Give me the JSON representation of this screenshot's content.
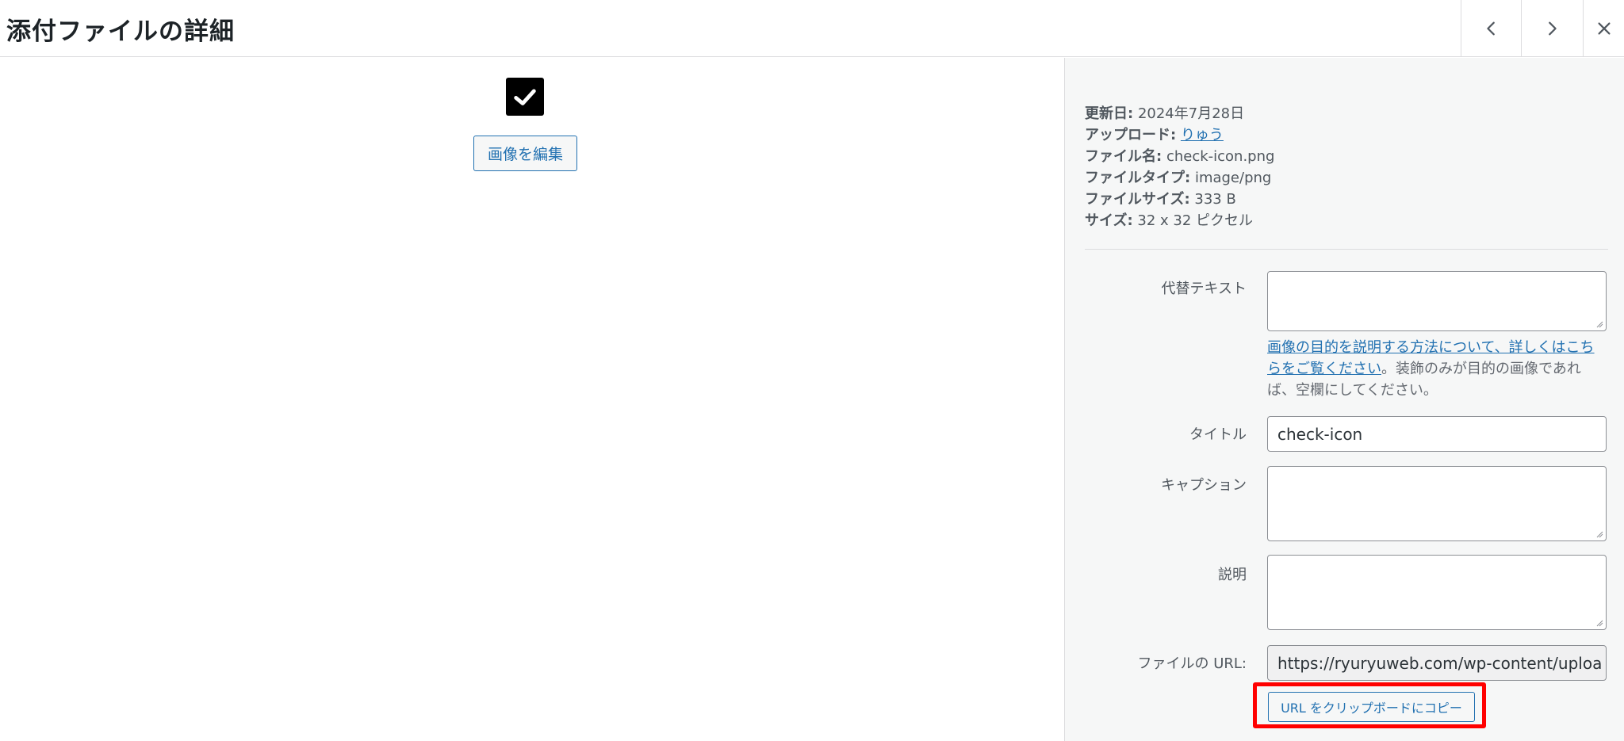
{
  "header": {
    "title": "添付ファイルの詳細",
    "icons": {
      "prev": "chevron-left-icon",
      "next": "chevron-right-icon",
      "close": "close-icon"
    }
  },
  "preview": {
    "thumbnail_icon": "checkmark-icon",
    "edit_label": "画像を編集"
  },
  "meta": {
    "updated_key": "更新日:",
    "updated_val": "2024年7月28日",
    "uploader_key": "アップロード:",
    "uploader_val": "りゅう",
    "filename_key": "ファイル名:",
    "filename_val": "check-icon.png",
    "filetype_key": "ファイルタイプ:",
    "filetype_val": "image/png",
    "filesize_key": "ファイルサイズ:",
    "filesize_val": "333 B",
    "dimensions_key": "サイズ:",
    "dimensions_val": "32 x 32 ピクセル"
  },
  "form": {
    "alt_label": "代替テキスト",
    "alt_value": "",
    "alt_help_link": "画像の目的を説明する方法について、詳しくはこちらをご覧ください",
    "alt_help_text": "。装飾のみが目的の画像であれば、空欄にしてください。",
    "title_label": "タイトル",
    "title_value": "check-icon",
    "caption_label": "キャプション",
    "caption_value": "",
    "description_label": "説明",
    "description_value": "",
    "url_label": "ファイルの URL:",
    "url_value": "https://ryuryuweb.com/wp-content/uploa",
    "copy_label": "URL をクリップボードにコピー"
  },
  "colors": {
    "accent": "#2271b1",
    "highlight": "#ff0000",
    "sidebar_bg": "#f6f7f7"
  }
}
